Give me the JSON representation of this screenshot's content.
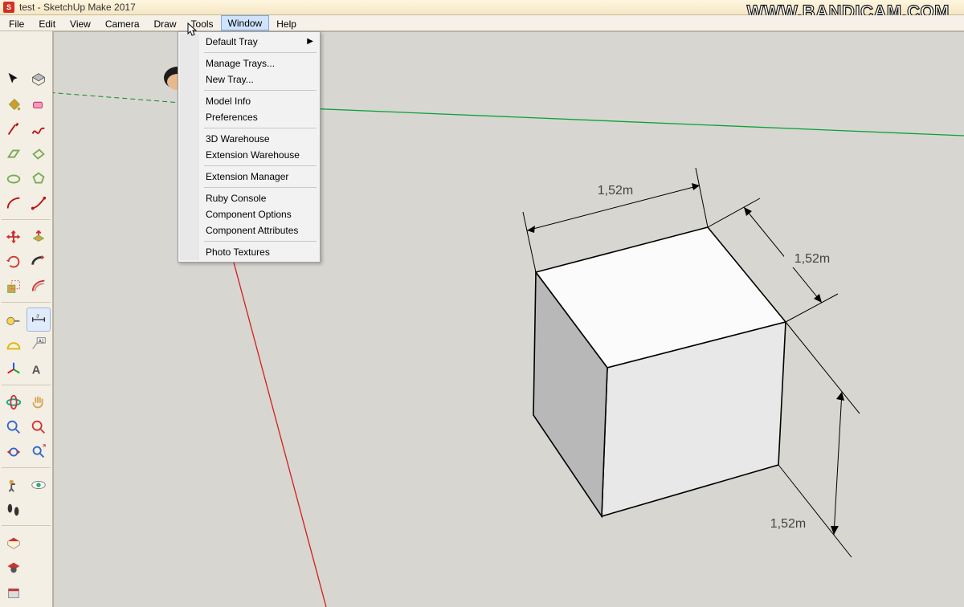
{
  "window": {
    "title": "test - SketchUp Make 2017"
  },
  "watermark": "WWW.BANDICAM.COM",
  "menu": {
    "items": [
      "File",
      "Edit",
      "View",
      "Camera",
      "Draw",
      "Tools",
      "Window",
      "Help"
    ],
    "active_index": 6
  },
  "dropdown": {
    "groups": [
      [
        {
          "label": "Default Tray",
          "submenu": true
        }
      ],
      [
        {
          "label": "Manage Trays..."
        },
        {
          "label": "New Tray..."
        }
      ],
      [
        {
          "label": "Model Info"
        },
        {
          "label": "Preferences"
        }
      ],
      [
        {
          "label": "3D Warehouse"
        },
        {
          "label": "Extension Warehouse"
        }
      ],
      [
        {
          "label": "Extension Manager"
        }
      ],
      [
        {
          "label": "Ruby Console"
        },
        {
          "label": "Component Options"
        },
        {
          "label": "Component Attributes"
        }
      ],
      [
        {
          "label": "Photo Textures"
        }
      ]
    ]
  },
  "dimensions": {
    "width": "1,52m",
    "height": "1,52m",
    "depth": "1,52m"
  },
  "annotation": {
    "points_to_item": "Model Info"
  },
  "tools": {
    "row_a": [
      "select",
      "component"
    ],
    "row_b": [
      "paint",
      "eraser"
    ],
    "row_c": [
      "line",
      "freehand"
    ],
    "row_d": [
      "rectangle",
      "rot-rect"
    ],
    "row_e": [
      "circle",
      "polygon"
    ],
    "row_f": [
      "arc",
      "2pt-arc"
    ],
    "row_g": [
      "move",
      "rotate"
    ],
    "row_h": [
      "follow",
      "pushpull"
    ],
    "row_i": [
      "scale",
      "offset"
    ],
    "row_j": [
      "tape",
      "dimension"
    ],
    "row_k": [
      "protractor",
      "text"
    ],
    "row_l": [
      "axes",
      "label"
    ],
    "row_m": [
      "orbit",
      "pan"
    ],
    "row_n": [
      "zoom",
      "zoom-window"
    ],
    "row_o": [
      "prev",
      "zoom-ext"
    ],
    "row_p": [
      "position",
      "look"
    ],
    "row_q": [
      "walk",
      ""
    ],
    "row_s1": [
      "warehouse",
      ""
    ],
    "row_s2": [
      "ext-warehouse",
      ""
    ],
    "row_s3": [
      "ext-manager",
      ""
    ]
  }
}
